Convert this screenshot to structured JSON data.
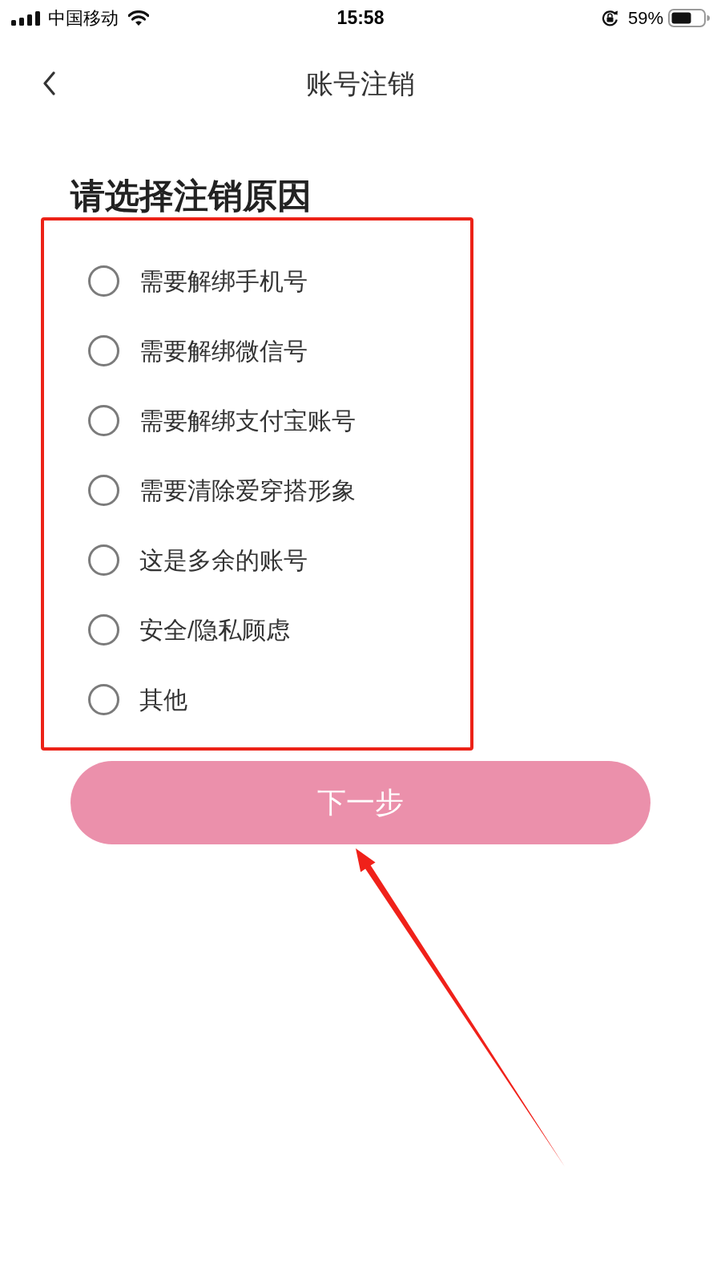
{
  "status_bar": {
    "carrier": "中国移动",
    "time": "15:58",
    "battery": "59%"
  },
  "nav_bar": {
    "title": "账号注销"
  },
  "heading": "请选择注销原因",
  "reasons": [
    {
      "label": "需要解绑手机号",
      "selected": false
    },
    {
      "label": "需要解绑微信号",
      "selected": false
    },
    {
      "label": "需要解绑支付宝账号",
      "selected": false
    },
    {
      "label": "需要清除爱穿搭形象",
      "selected": false
    },
    {
      "label": "这是多余的账号",
      "selected": false
    },
    {
      "label": "安全/隐私顾虑",
      "selected": false
    },
    {
      "label": "其他",
      "selected": false
    }
  ],
  "next_button": {
    "label": "下一步",
    "disabled": true
  }
}
